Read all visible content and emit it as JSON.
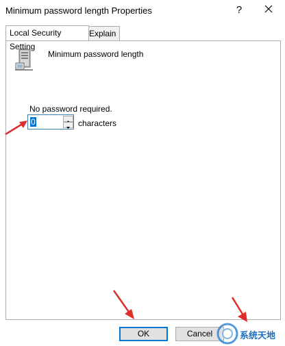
{
  "window": {
    "title": "Minimum password length Properties",
    "help_glyph": "?",
    "close_glyph": "✕"
  },
  "tabs": [
    {
      "label": "Local Security Setting",
      "active": true
    },
    {
      "label": "Explain",
      "active": false
    }
  ],
  "policy": {
    "icon": "server-icon",
    "name": "Minimum password length",
    "status_text": "No password required.",
    "value": "0",
    "unit_label": "characters"
  },
  "buttons": {
    "ok_label": "OK",
    "cancel_label": "Cancel"
  },
  "watermark": {
    "text": "系统天地"
  },
  "colors": {
    "accent": "#0078d7",
    "annotation_arrow": "#e02b2b"
  }
}
